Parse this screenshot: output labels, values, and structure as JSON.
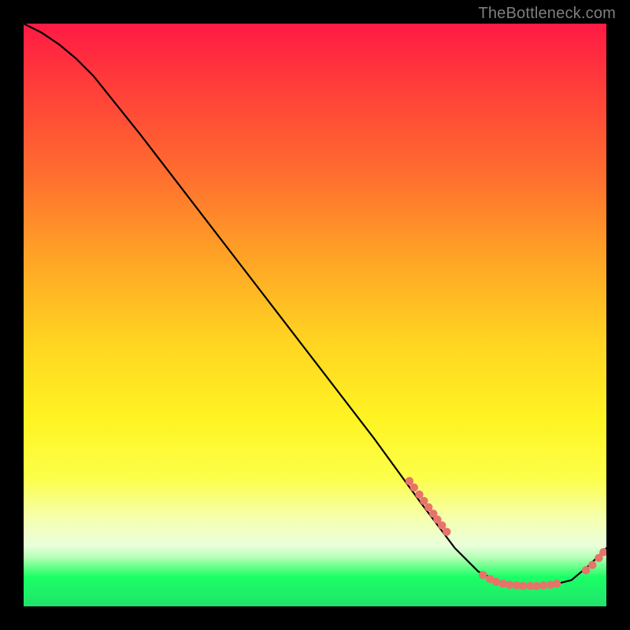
{
  "watermark": "TheBottleneck.com",
  "chart_data": {
    "type": "line",
    "title": "",
    "xlabel": "",
    "ylabel": "",
    "xlim": [
      0,
      100
    ],
    "ylim": [
      0,
      100
    ],
    "grid": false,
    "legend": false,
    "series": [
      {
        "name": "bottleneck-curve",
        "color": "#000000",
        "x": [
          0,
          3,
          6,
          9,
          12,
          20,
          30,
          40,
          50,
          60,
          68,
          74,
          78,
          82,
          86,
          90,
          94,
          97,
          100
        ],
        "y": [
          100,
          98.5,
          96.5,
          94,
          91,
          81,
          68,
          55,
          42,
          29,
          18,
          10,
          6,
          4,
          3.5,
          3.5,
          4.5,
          7,
          10
        ]
      }
    ],
    "markers": [
      {
        "name": "cluster-upper-descent",
        "color": "#e7736a",
        "points": [
          {
            "x": 66.2,
            "y": 21.5
          },
          {
            "x": 67.0,
            "y": 20.4
          },
          {
            "x": 67.9,
            "y": 19.2
          },
          {
            "x": 68.7,
            "y": 18.1
          },
          {
            "x": 69.5,
            "y": 17.0
          },
          {
            "x": 70.3,
            "y": 15.9
          },
          {
            "x": 71.0,
            "y": 14.9
          },
          {
            "x": 71.8,
            "y": 13.9
          },
          {
            "x": 72.6,
            "y": 12.8
          }
        ]
      },
      {
        "name": "cluster-valley-floor",
        "color": "#e7736a",
        "points": [
          {
            "x": 78.8,
            "y": 5.4
          },
          {
            "x": 80.0,
            "y": 4.7
          },
          {
            "x": 81.1,
            "y": 4.2
          },
          {
            "x": 82.3,
            "y": 3.9
          },
          {
            "x": 83.4,
            "y": 3.7
          },
          {
            "x": 84.6,
            "y": 3.6
          },
          {
            "x": 85.7,
            "y": 3.5
          },
          {
            "x": 86.9,
            "y": 3.5
          },
          {
            "x": 88.0,
            "y": 3.5
          },
          {
            "x": 89.2,
            "y": 3.6
          },
          {
            "x": 90.4,
            "y": 3.7
          },
          {
            "x": 91.5,
            "y": 3.9
          }
        ]
      },
      {
        "name": "cluster-right-rise",
        "color": "#e7736a",
        "points": [
          {
            "x": 96.5,
            "y": 6.2
          },
          {
            "x": 97.6,
            "y": 7.1
          },
          {
            "x": 98.7,
            "y": 8.3
          },
          {
            "x": 99.5,
            "y": 9.3
          }
        ]
      }
    ]
  }
}
